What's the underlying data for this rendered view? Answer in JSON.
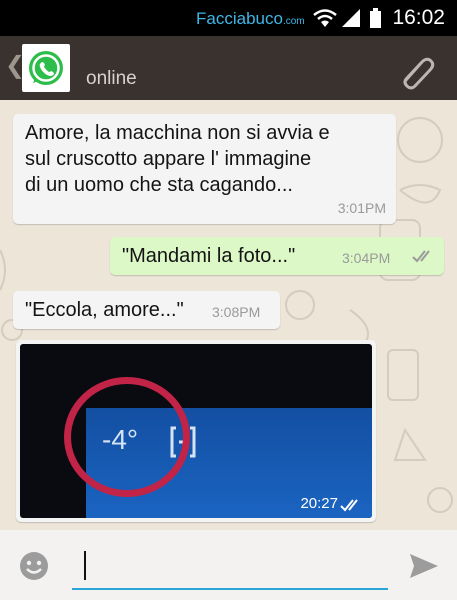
{
  "status_bar": {
    "brand": "Facciabuco",
    "brand_suffix": ".com",
    "time": "16:02"
  },
  "header": {
    "back_icon": "chevron-left-icon",
    "avatar_icon": "whatsapp-logo",
    "status": "online",
    "attach_icon": "paperclip-icon"
  },
  "messages": [
    {
      "direction": "incoming",
      "lines": [
        "Amore, la macchina non si avvia e",
        "sul cruscotto appare l' immagine",
        "di un uomo che sta cagando..."
      ],
      "time": "3:01PM"
    },
    {
      "direction": "outgoing",
      "text": "\"Mandami la foto...\"",
      "time": "3:04PM",
      "ticks": "double-check"
    },
    {
      "direction": "incoming",
      "text": "\"Eccola, amore...\"",
      "time": "3:08PM"
    },
    {
      "direction": "incoming",
      "type": "image",
      "image_text": "-4°",
      "time": "20:27",
      "ticks": "double-check"
    }
  ],
  "input_bar": {
    "emoji_icon": "smiley-icon",
    "placeholder": "",
    "value": "",
    "send_icon": "send-icon"
  },
  "colors": {
    "status_bar": "#000000",
    "action_bar": "#39322f",
    "chat_bg": "#ece5d8",
    "incoming_bubble": "#f4f4f4",
    "outgoing_bubble": "#dcf8c6",
    "brand_text": "#3fb6e6",
    "input_underline": "#2ba4d8",
    "photo_circle": "#c22448"
  }
}
